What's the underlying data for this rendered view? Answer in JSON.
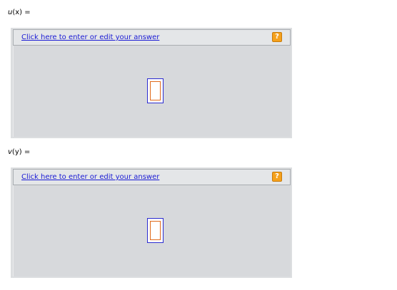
{
  "questions": [
    {
      "var_name": "u",
      "argument": "(x) =",
      "link_text": "Click here to enter or edit your answer",
      "help_icon": "question-mark",
      "help_label": "?"
    },
    {
      "var_name": "v",
      "argument": "(y) =",
      "link_text": "Click here to enter or edit your answer",
      "help_icon": "question-mark",
      "help_label": "?"
    }
  ],
  "colors": {
    "link": "#1a1ad4",
    "help_button": "#f5a11c",
    "panel_background": "#d7d9dc",
    "placeholder_outer": "#2b2bd0",
    "placeholder_inner": "#e06a1a"
  }
}
